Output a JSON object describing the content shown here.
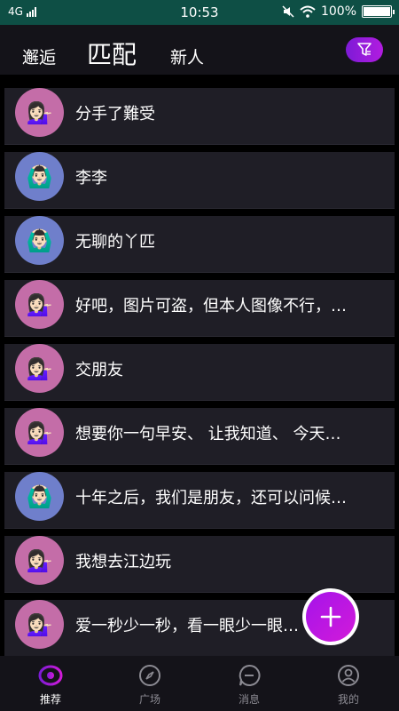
{
  "status_bar": {
    "network": "4G",
    "time": "10:53",
    "battery": "100%",
    "battery_level": 1.0
  },
  "header": {
    "tabs": [
      {
        "label": "邂逅",
        "active": false
      },
      {
        "label": "匹配",
        "active": true
      },
      {
        "label": "新人",
        "active": false
      }
    ],
    "filter_icon": "filter-icon",
    "accent_gradient": [
      "#7d1bd6",
      "#b21ce0"
    ]
  },
  "list": {
    "items": [
      {
        "text": "分手了難受",
        "avatar": "woman-tipping-hand-emoji",
        "avatar_color": "#c46da8"
      },
      {
        "text": "李李",
        "avatar": "person-gesturing-ok-emoji",
        "avatar_color": "#6f7fcb"
      },
      {
        "text": "无聊的丫匹",
        "avatar": "person-gesturing-ok-emoji",
        "avatar_color": "#6f7fcb"
      },
      {
        "text": "好吧，图片可盗，但本人图像不行，…",
        "avatar": "woman-tipping-hand-emoji",
        "avatar_color": "#c46da8"
      },
      {
        "text": "交朋友",
        "avatar": "woman-tipping-hand-emoji",
        "avatar_color": "#c46da8"
      },
      {
        "text": "想要你一句早安、 让我知道、 今天…",
        "avatar": "woman-tipping-hand-emoji",
        "avatar_color": "#c46da8"
      },
      {
        "text": "十年之后，我们是朋友，还可以问候…",
        "avatar": "person-gesturing-ok-emoji",
        "avatar_color": "#6f7fcb"
      },
      {
        "text": "我想去江边玩",
        "avatar": "woman-tipping-hand-emoji",
        "avatar_color": "#c46da8"
      },
      {
        "text": "爱一秒少一秒，看一眼少一眼…",
        "avatar": "woman-tipping-hand-emoji",
        "avatar_color": "#c46da8"
      }
    ]
  },
  "fab": {
    "icon": "plus-icon",
    "colors": [
      "#a513ea",
      "#d21bd9"
    ]
  },
  "bottom_nav": {
    "items": [
      {
        "label": "推荐",
        "icon": "eye-icon",
        "active": true
      },
      {
        "label": "广场",
        "icon": "compass-icon",
        "active": false
      },
      {
        "label": "消息",
        "icon": "message-icon",
        "active": false
      },
      {
        "label": "我的",
        "icon": "profile-icon",
        "active": false
      }
    ]
  }
}
